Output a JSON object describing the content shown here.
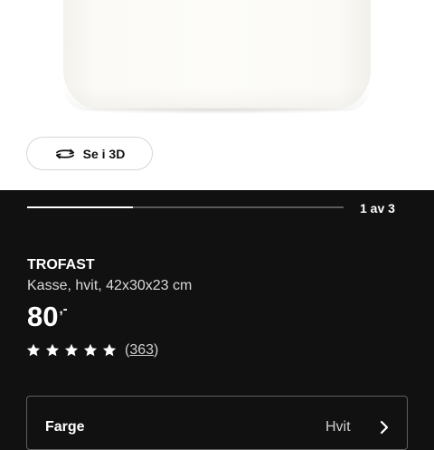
{
  "product_image": {
    "view_3d_label": "Se i 3D",
    "gallery_progress": 0.333,
    "image_counter": "1 av 3"
  },
  "product": {
    "name": "TROFAST",
    "description": "Kasse, hvit, 42x30x23 cm",
    "price_amount": "80",
    "price_suffix": ",-",
    "rating_stars": 5,
    "review_count_open": "(",
    "review_count": "363",
    "review_count_close": ")"
  },
  "color_selector": {
    "label": "Farge",
    "value": "Hvit"
  },
  "icons": {
    "view_3d": "rotate-3d-icon",
    "star": "star-icon",
    "chevron": "chevron-right-icon"
  },
  "colors": {
    "background": "#111111",
    "text": "#ffffff",
    "secondary_text": "#cfcfcf",
    "progress_track": "#5a5a5a"
  }
}
